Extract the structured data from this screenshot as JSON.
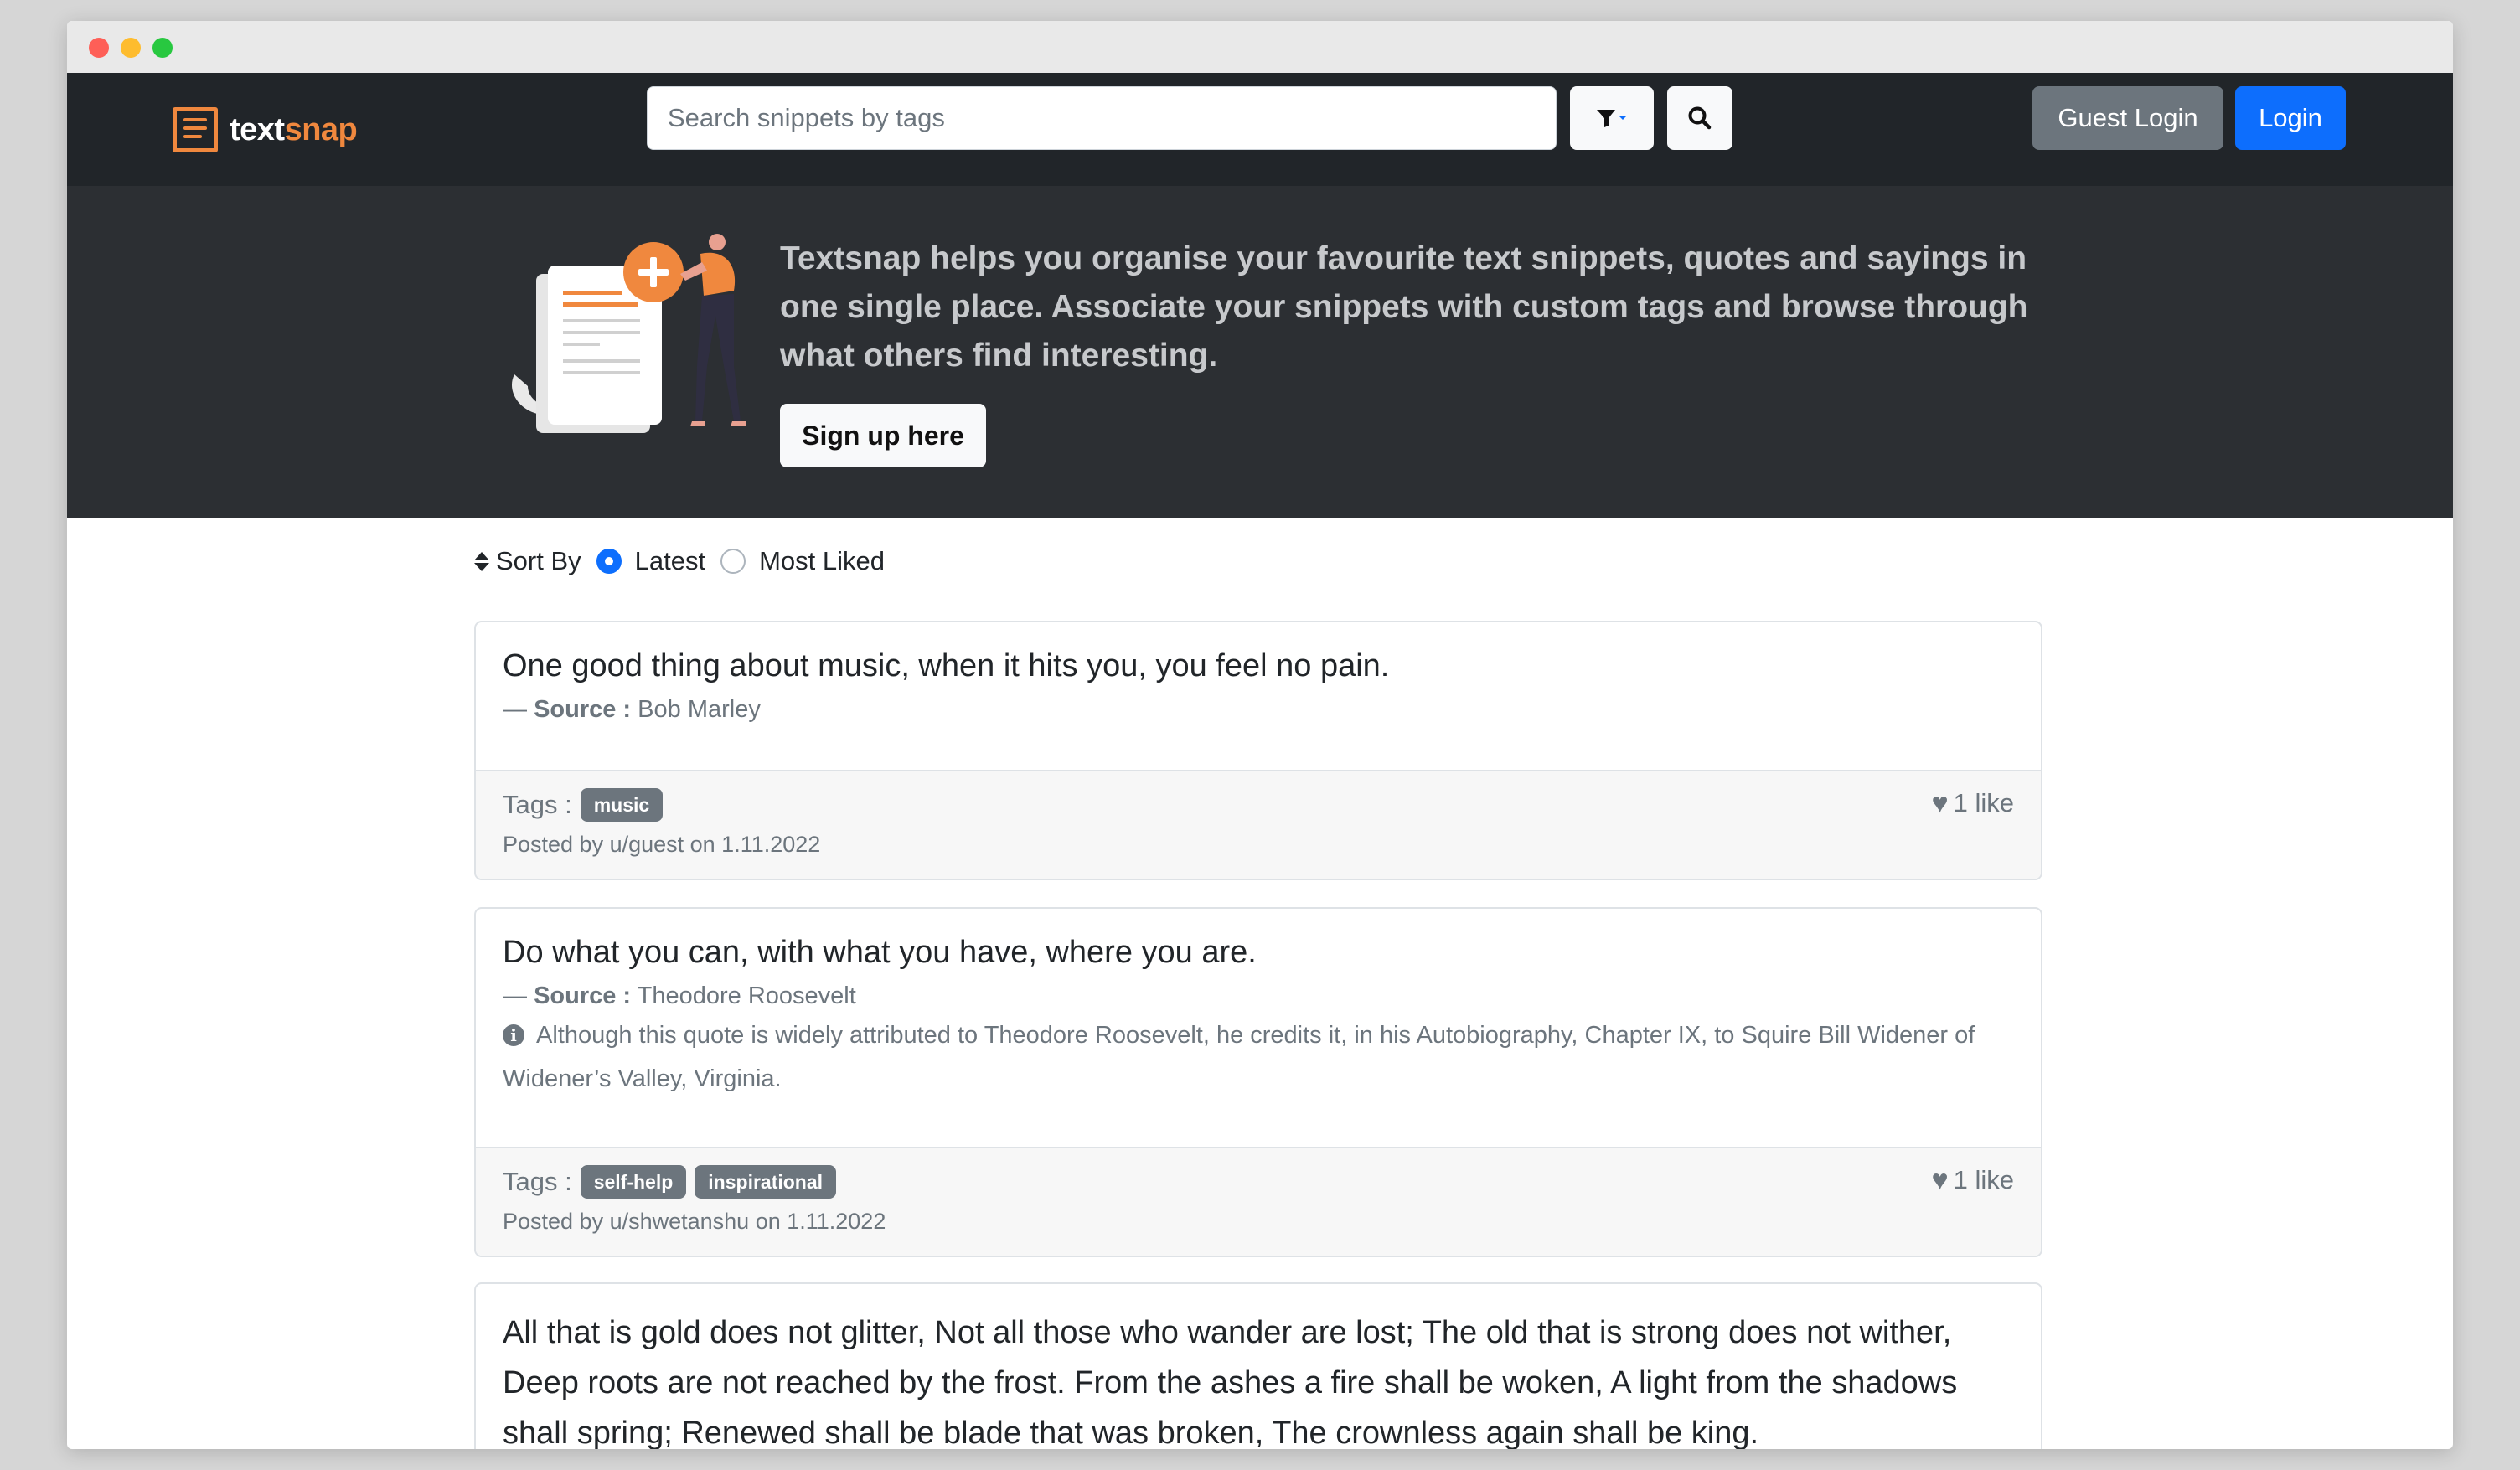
{
  "app": {
    "brand_prefix": "text",
    "brand_suffix": "snap",
    "accent_color": "#f0883e",
    "primary_color": "#0d6efd"
  },
  "navbar": {
    "search_placeholder": "Search snippets by tags",
    "filter_icon": "funnel-dropdown-icon",
    "search_icon": "magnifier-icon",
    "guest_login_label": "Guest Login",
    "login_label": "Login"
  },
  "hero": {
    "text": "Textsnap helps you organise your favourite text snippets, quotes and sayings in one single place. Associate your snippets with custom tags and browse through what others find interesting.",
    "signup_label": "Sign up here"
  },
  "sort": {
    "label": "Sort By",
    "options": [
      "Latest",
      "Most Liked"
    ],
    "selected": "Latest"
  },
  "snippets": [
    {
      "text": "One good thing about music, when it hits you, you feel no pain.",
      "source_prefix": "— ",
      "source_label": "Source :",
      "source": "Bob Marley",
      "note": "",
      "tags_label": "Tags :",
      "tags": [
        "music"
      ],
      "posted": "Posted by u/guest on 1.11.2022",
      "likes": "1 like"
    },
    {
      "text": "Do what you can, with what you have, where you are.",
      "source_prefix": "— ",
      "source_label": "Source :",
      "source": "Theodore Roosevelt",
      "note": "Although this quote is widely attributed to Theodore Roosevelt, he credits it, in his Autobiography, Chapter IX, to Squire Bill Widener of Widener’s Valley, Virginia.",
      "tags_label": "Tags :",
      "tags": [
        "self-help",
        "inspirational"
      ],
      "posted": "Posted by u/shwetanshu on 1.11.2022",
      "likes": "1 like"
    },
    {
      "text": "All that is gold does not glitter, Not all those who wander are lost; The old that is strong does not wither, Deep roots are not reached by the frost. From the ashes a fire shall be woken, A light from the shadows shall spring; Renewed shall be blade that was broken, The crownless again shall be king."
    }
  ]
}
